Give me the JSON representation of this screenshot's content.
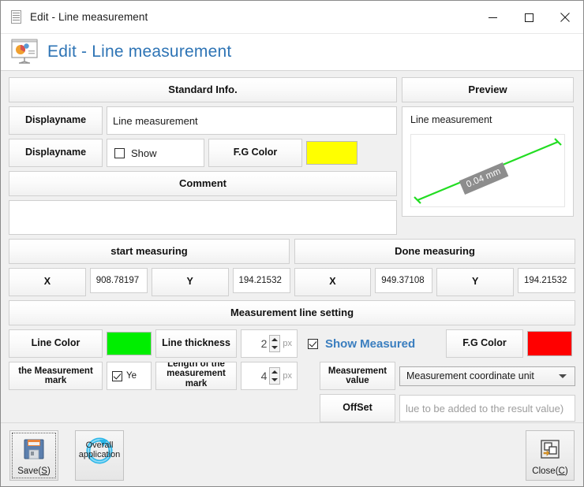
{
  "window": {
    "title": "Edit - Line measurement",
    "icon": "document-icon",
    "minimize": "minimize-icon",
    "maximize": "maximize-icon",
    "close": "close-icon"
  },
  "header": {
    "title": "Edit - Line measurement",
    "icon": "presentation-chart-icon"
  },
  "standard_info": {
    "section_title": "Standard Info.",
    "rows": [
      {
        "label": "Displayname",
        "value": "Line measurement"
      },
      {
        "label": "Displayname",
        "checkbox_label": "Show",
        "checked": false,
        "color_button": "F.G Color",
        "color_value": "#ffff00"
      }
    ],
    "comment_title": "Comment",
    "comment_value": ""
  },
  "preview": {
    "section_title": "Preview",
    "caption": "Line measurement",
    "measure_label": "0.04 mm",
    "line_color": "#22dd22",
    "label_background": "#8d8d8d"
  },
  "measuring": {
    "start_title": "start measuring",
    "done_title": "Done measuring",
    "start": {
      "x_label": "X",
      "x_value": "908.78197",
      "y_label": "Y",
      "y_value": "194.21532"
    },
    "done": {
      "x_label": "X",
      "x_value": "949.37108",
      "y_label": "Y",
      "y_value": "194.21532"
    }
  },
  "line_setting": {
    "section_title": "Measurement line setting",
    "line_color_label": "Line Color",
    "line_color_value": "#00ee00",
    "line_thickness_label": "Line thickness",
    "line_thickness_value": "2",
    "line_thickness_unit": "px",
    "show_measured_label": "Show Measured",
    "show_measured_checked": true,
    "fg_color_label": "F.G Color",
    "fg_color_value": "#ff0000",
    "mark_label": "the Measurement mark",
    "mark_checkbox_label": "Ye",
    "mark_checked": true,
    "mark_length_label": "Length of the measurement mark",
    "mark_length_value": "4",
    "mark_length_unit": "px",
    "measurement_value_label": "Measurement value",
    "measurement_unit_selected": "Measurement coordinate unit",
    "offset_label": "OffSet",
    "offset_placeholder": "lue to be added to the result value)"
  },
  "footer": {
    "save_label": "Save(S)",
    "save_accel": "S",
    "save_icon": "floppy-disk-icon",
    "overall_label": "Overall application",
    "overall_icon": "refresh-circle-icon",
    "close_label": "Close(C)",
    "close_accel": "C",
    "close_icon": "windows-stack-icon"
  }
}
